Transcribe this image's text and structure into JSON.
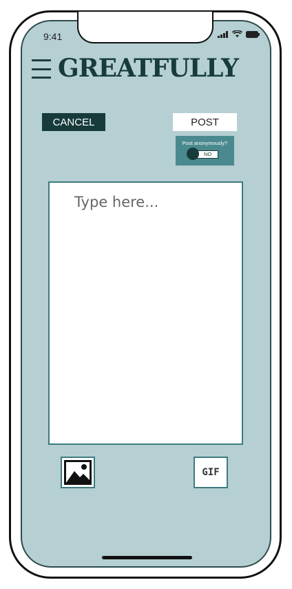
{
  "status_bar": {
    "time": "9:41"
  },
  "header": {
    "logo": "GREATFULLY"
  },
  "actions": {
    "cancel_label": "CANCEL",
    "post_label": "POST"
  },
  "anonymous": {
    "label": "Post anonymously?",
    "value": "NO"
  },
  "composer": {
    "placeholder": "Type here..."
  },
  "attachments": {
    "gif_label": "GIF"
  },
  "colors": {
    "screen_bg": "#b5cfd2",
    "accent_dark": "#173b3b",
    "accent": "#4a8a8f"
  },
  "icons": [
    "menu-icon",
    "signal-icon",
    "wifi-icon",
    "battery-icon",
    "image-icon"
  ]
}
